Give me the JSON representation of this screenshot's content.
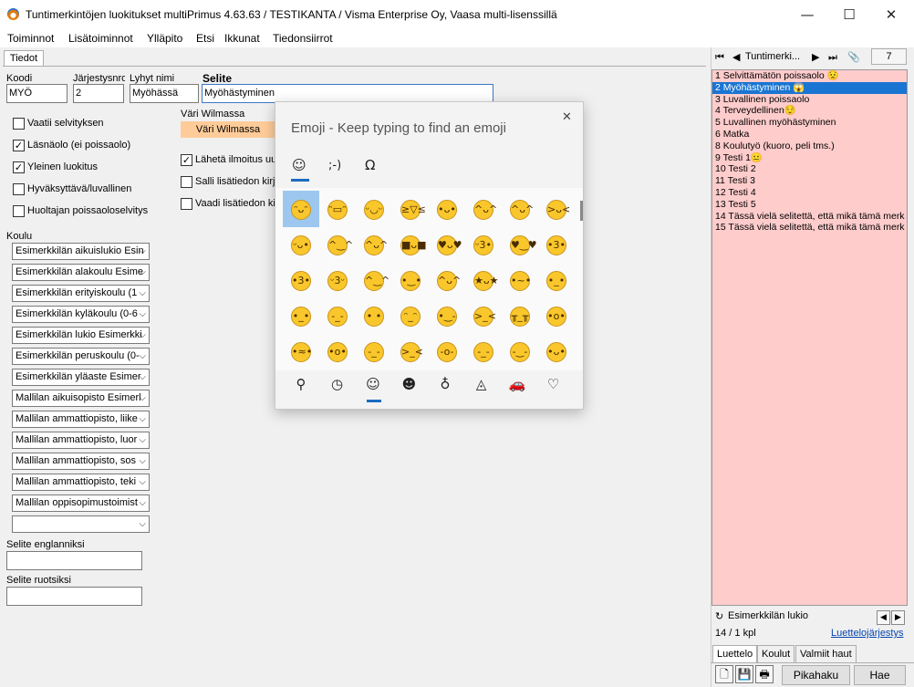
{
  "window": {
    "title": "Tuntimerkintöjen luokitukset multiPrimus 4.63.63 / TESTIKANTA / Visma Enterprise Oy, Vaasa multi-lisenssillä",
    "minimize": "—",
    "maximize": "☐",
    "close": "✕"
  },
  "menu": [
    "Toiminnot",
    "Lisätoiminnot",
    "Ylläpito",
    "Etsi",
    "Ikkunat",
    "Tiedonsiirrot"
  ],
  "tab": "Tiedot",
  "form": {
    "koodi_label": "Koodi",
    "koodi": "MYÖ",
    "jarjestys_label": "Järjestysnro",
    "jarjestys": "2",
    "lyhyt_label": "Lyhyt nimi",
    "lyhyt": "Myöhässä",
    "selite_label": "Selite",
    "selite": "Myöhästyminen",
    "vari_label": "Väri Wilmassa",
    "vari_button": "Väri Wilmassa",
    "checks_left": [
      {
        "label": "Vaatii selvityksen",
        "checked": false
      },
      {
        "label": "Läsnäolo (ei poissaolo)",
        "checked": true
      },
      {
        "label": "Yleinen luokitus",
        "checked": true
      },
      {
        "label": "Hyväksyttävä/luvallinen",
        "checked": false
      },
      {
        "label": "Huoltajan poissaoloselvitys",
        "checked": false
      }
    ],
    "checks_right": [
      {
        "label": "Lähetä ilmoitus uud",
        "checked": true
      },
      {
        "label": "Salli lisätiedon kirja",
        "checked": false
      },
      {
        "label": "Vaadi lisätiedon kirj",
        "checked": false
      }
    ],
    "koulu_label": "Koulu",
    "koulut": [
      "Esimerkkilän aikuislukio Esin",
      "Esimerkkilän alakoulu Esime",
      "Esimerkkilän erityiskoulu (1",
      "Esimerkkilän kyläkoulu (0-6",
      "Esimerkkilän lukio Esimerkki",
      "Esimerkkilän peruskoulu (0-",
      "Esimerkkilän yläaste Esimer",
      "Mallilan aikuisopisto Esimerl",
      "Mallilan ammattiopisto, liike",
      "Mallilan ammattiopisto, luor",
      "Mallilan ammattiopisto, sos",
      "Mallilan ammattiopisto, teki",
      "Mallilan oppisopimustoimist",
      ""
    ],
    "selite_en_label": "Selite englanniksi",
    "selite_en": "",
    "selite_sv_label": "Selite ruotsiksi",
    "selite_sv": ""
  },
  "emoji_panel": {
    "title": "Emoji - Keep typing to find an emoji",
    "close": "✕",
    "tabs": [
      "☺",
      ";-)",
      "Ω"
    ],
    "grid_icons": [
      "grinning-face",
      "grimacing-face",
      "joy-face",
      "rofl-face",
      "smiley-face",
      "smile-face",
      "sweat-smile-face",
      "laughing-face",
      "wink-face",
      "blush-face",
      "yum-face",
      "sunglasses-face",
      "heart-eyes-face",
      "kissing-heart-face",
      "hearts-face",
      "kissing-face",
      "kissing-smiling-face",
      "kissing-closed-eyes-face",
      "relaxed-face",
      "slight-smile-face",
      "hugging-face",
      "star-struck-face",
      "thinking-face",
      "neutral-hushed-face",
      "neutral-face",
      "expressionless-face",
      "no-mouth-face",
      "rolling-eyes-face",
      "smirk-face",
      "persevere-face",
      "disappointed-relieved-face",
      "open-mouth-face",
      "zipper-mouth-face",
      "hushed-face",
      "sleepy-face",
      "tired-face",
      "sleeping-face",
      "sleeping-zzz-face",
      "relieved-face",
      "tongue-face"
    ],
    "grid_glyphs": [
      "ᵔᴗᵔ",
      "ᵔ▭ᵔ",
      "ᵕ◡ᵕ",
      "≥▽≤",
      "•ᴗ•",
      "^ᴗ^",
      "^ᴗ^",
      ">ᴗ<",
      "ᵕᴗ•",
      "^‿^",
      "^ᴗ^",
      "■ᴗ■",
      "♥ᴗ♥",
      "ᵕ3•",
      "♥‿♥",
      "•3•",
      "•3•",
      "ᵕ3ᵕ",
      "^‿^",
      "•‿•",
      "^ᴗ^",
      "★ᴗ★",
      "•~•",
      "•_•",
      "•_•",
      "-_-",
      "•  •",
      "ᵔ_ᵔ",
      "•‿-",
      ">_<",
      "╥_╥",
      "•o•",
      "•≈•",
      "•o•",
      "-_-",
      ">_<",
      "-o-",
      "-_-",
      "-‿-",
      "•ᴗ•"
    ],
    "categories": [
      "search-icon",
      "recent-clock-icon",
      "smiley-icon",
      "people-icon",
      "balloon-icon",
      "pizza-icon",
      "car-icon",
      "heart-icon"
    ],
    "category_glyphs": [
      "⚲",
      "◷",
      "☺",
      "☻",
      "♁",
      "◬",
      "🚗",
      "♡"
    ]
  },
  "rpane": {
    "first": "⏮",
    "prev": "◀",
    "nav_label": "Tuntimerki...",
    "next": "▶",
    "last": "⏭",
    "attach": "📎",
    "count": "7",
    "records": [
      "1 Selvittämätön poissaolo 😟",
      "2 Myöhästyminen 😱",
      "3 Luvallinen poissaolo",
      "4 Terveydellinen😌",
      "5 Luvallinen myöhästyminen",
      "6 Matka",
      "8 Koulutyö (kuoro, peli tms.)",
      "9 Testi 1😐",
      "10 Testi 2",
      "11 Testi 3",
      "12 Testi 4",
      "13 Testi 5",
      "14 Tässä vielä selitettä, että mikä tämä merk",
      "15 Tässä vielä selitettä, että mikä tämä merk"
    ],
    "selected_index": 1,
    "school": "Esimerkkilän lukio",
    "refresh": "↻",
    "scroll_left": "◀",
    "scroll_right": "▶",
    "count_text": "14 / 1 kpl",
    "order_link": "Luettelojärjestys",
    "tabs": [
      "Luettelo",
      "Koulut",
      "Valmiit haut"
    ],
    "new_icon": "🗋",
    "save_icon": "💾",
    "print_icon": "🖶",
    "pikahaku": "Pikahaku",
    "hae": "Hae"
  }
}
